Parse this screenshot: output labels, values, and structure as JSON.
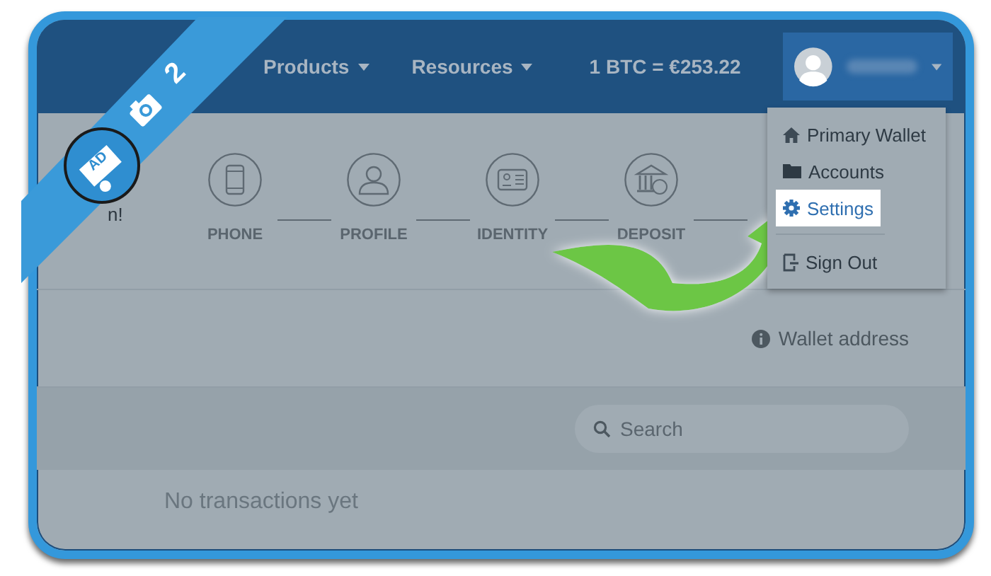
{
  "nav": {
    "items": [
      {
        "label": "Products",
        "dropdown": true
      },
      {
        "label": "Resources",
        "dropdown": true
      }
    ],
    "rate": "1 BTC = €253.22"
  },
  "user_menu": {
    "expanded": true,
    "items": [
      {
        "label": "Primary Wallet",
        "selected": false,
        "separated": false
      },
      {
        "label": "Accounts",
        "selected": false,
        "separated": false
      },
      {
        "label": "Settings",
        "selected": true,
        "separated": false
      },
      {
        "label": "Sign Out",
        "selected": false,
        "separated": true
      }
    ]
  },
  "intro_text": "n!",
  "steps": [
    {
      "label": "PHONE"
    },
    {
      "label": "PROFILE"
    },
    {
      "label": "IDENTITY"
    },
    {
      "label": "DEPOSIT"
    }
  ],
  "wallet_link": "Wallet address",
  "search": {
    "placeholder": "Search"
  },
  "empty_message": "No transactions yet",
  "ribbon": {
    "logo_text": "AD",
    "step": "2"
  }
}
